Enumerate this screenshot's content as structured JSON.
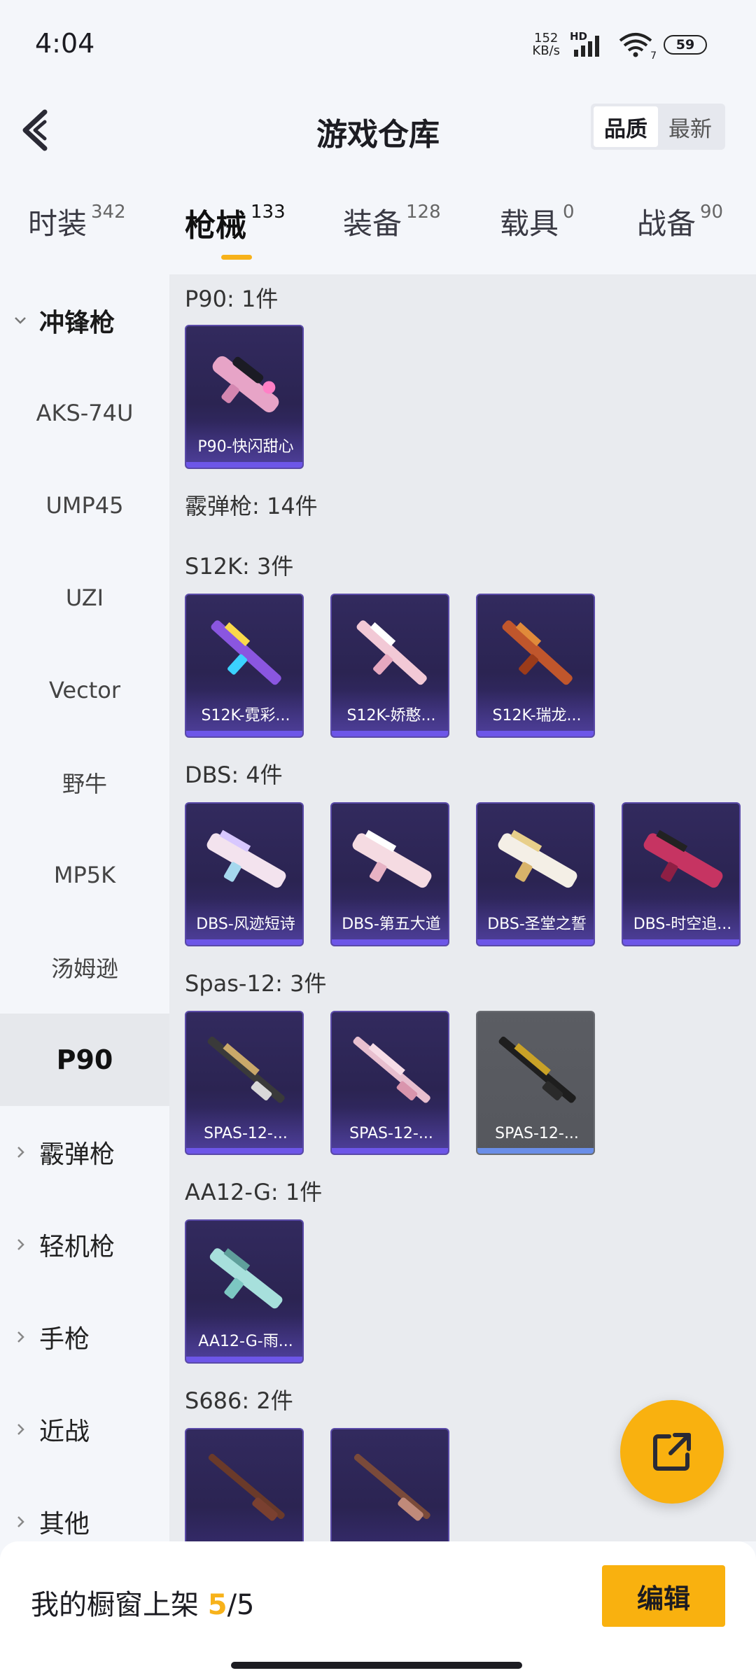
{
  "status": {
    "time": "4:04",
    "net_speed_value": "152",
    "net_speed_unit": "KB/s",
    "hd": "HD",
    "wifi_num": "7",
    "battery": "59"
  },
  "header": {
    "title": "游戏仓库",
    "sort_quality": "品质",
    "sort_latest": "最新"
  },
  "tabs": [
    {
      "label": "时装",
      "count": "342"
    },
    {
      "label": "枪械",
      "count": "133"
    },
    {
      "label": "装备",
      "count": "128"
    },
    {
      "label": "载具",
      "count": "0"
    },
    {
      "label": "战备",
      "count": "90"
    }
  ],
  "sidebar": {
    "categories": {
      "smg": "冲锋枪",
      "shotgun": "霰弹枪",
      "lmg": "轻机枪",
      "pistol": "手枪",
      "melee": "近战",
      "other": "其他"
    },
    "smg_items": [
      "AKS-74U",
      "UMP45",
      "UZI",
      "Vector",
      "野牛",
      "MP5K",
      "汤姆逊",
      "P90"
    ]
  },
  "content": {
    "p90": {
      "title": "P90: 1件",
      "items": [
        "P90-快闪甜心"
      ]
    },
    "shotgun_header": "霰弹枪: 14件",
    "s12k": {
      "title": "S12K: 3件",
      "items": [
        "S12K-霓彩...",
        "S12K-娇憨...",
        "S12K-瑞龙..."
      ]
    },
    "dbs": {
      "title": "DBS: 4件",
      "items": [
        "DBS-风迹短诗",
        "DBS-第五大道",
        "DBS-圣堂之誓",
        "DBS-时空追..."
      ]
    },
    "spas": {
      "title": "Spas-12: 3件",
      "items": [
        "SPAS-12-...",
        "SPAS-12-...",
        "SPAS-12-..."
      ]
    },
    "aa12": {
      "title": "AA12-G: 1件",
      "items": [
        "AA12-G-雨..."
      ]
    },
    "s686": {
      "title": "S686: 2件"
    }
  },
  "bottom": {
    "label": "我的橱窗上架",
    "current": "5",
    "separator": "/",
    "total": "5",
    "edit": "编辑"
  },
  "colors": {
    "accent": "#f9b10f",
    "card_purple": "#2b2452",
    "card_grey": "#55575d"
  }
}
